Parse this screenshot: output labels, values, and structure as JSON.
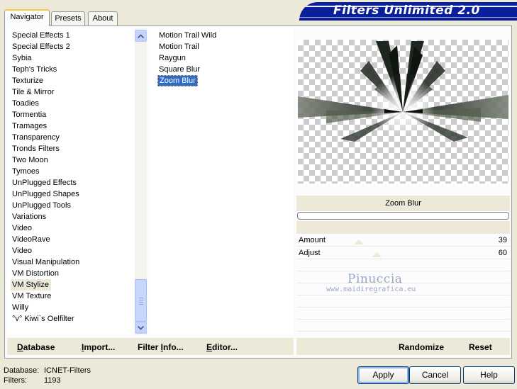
{
  "app": {
    "title": "Filters Unlimited 2.0"
  },
  "tabs": [
    {
      "label": "Navigator",
      "active": true
    },
    {
      "label": "Presets",
      "active": false
    },
    {
      "label": "About",
      "active": false
    }
  ],
  "categories": [
    "Special Effects 1",
    "Special Effects 2",
    "Sybia",
    "Teph's Tricks",
    "Texturize",
    "Tile & Mirror",
    "Toadies",
    "Tormentia",
    "Tramages",
    "Transparency",
    "Tronds Filters",
    "Two Moon",
    "Tymoes",
    "UnPlugged Effects",
    "UnPlugged Shapes",
    "UnPlugged Tools",
    "Variations",
    "Video",
    "VideoRave",
    "Video",
    "Visual Manipulation",
    "VM Distortion",
    "VM Stylize",
    "VM Texture",
    "Willy",
    "°v° Kiwi`s Oelfilter"
  ],
  "selected_category": "VM Stylize",
  "filters": [
    "Motion Trail Wild",
    "Motion Trail",
    "Raygun",
    "Square Blur",
    "Zoom Blur"
  ],
  "selected_filter": "Zoom Blur",
  "preview": {
    "filter_name": "Zoom Blur"
  },
  "params": [
    {
      "label": "Amount",
      "value": "39",
      "level": 39
    },
    {
      "label": "Adjust",
      "value": "60",
      "level": 60
    }
  ],
  "watermark": {
    "name": "Pinuccia",
    "url": "www.maidiregrafica.eu"
  },
  "buttons": {
    "database": {
      "underlined": "D",
      "rest": "atabase"
    },
    "import": {
      "underlined": "I",
      "rest": "mport..."
    },
    "filter_info": {
      "prefix": "Filter ",
      "underlined": "I",
      "rest": "nfo..."
    },
    "editor": {
      "underlined": "E",
      "rest": "ditor..."
    },
    "randomize": "Randomize",
    "reset": "Reset",
    "apply": "Apply",
    "cancel": "Cancel",
    "help": "Help"
  },
  "status": {
    "database_label": "Database:",
    "database_value": "ICNET-Filters",
    "filters_label": "Filters:",
    "filters_value": "1193"
  },
  "colors": {
    "banner": "#0a1f9a",
    "selection": "#316ac5"
  }
}
